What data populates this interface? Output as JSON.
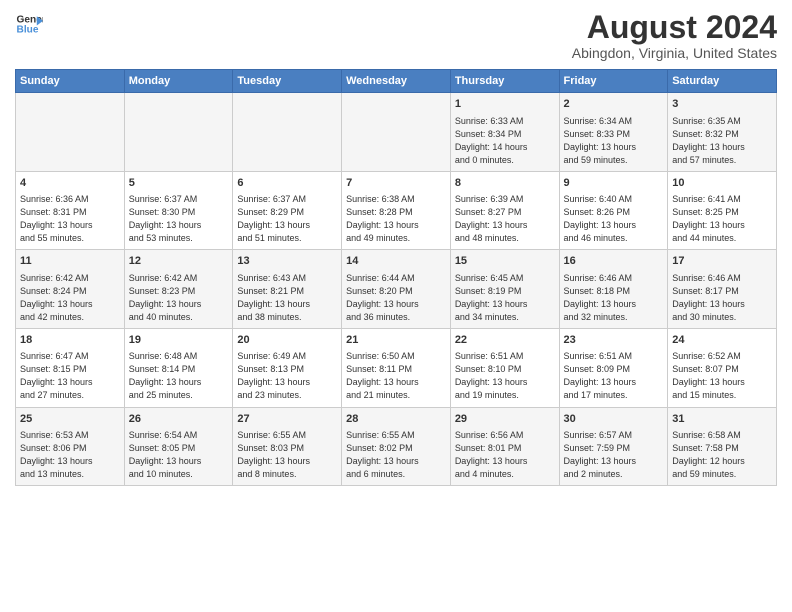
{
  "header": {
    "logo_line1": "General",
    "logo_line2": "Blue",
    "title": "August 2024",
    "subtitle": "Abingdon, Virginia, United States"
  },
  "columns": [
    "Sunday",
    "Monday",
    "Tuesday",
    "Wednesday",
    "Thursday",
    "Friday",
    "Saturday"
  ],
  "weeks": [
    [
      {
        "day": "",
        "lines": []
      },
      {
        "day": "",
        "lines": []
      },
      {
        "day": "",
        "lines": []
      },
      {
        "day": "",
        "lines": []
      },
      {
        "day": "1",
        "lines": [
          "Sunrise: 6:33 AM",
          "Sunset: 8:34 PM",
          "Daylight: 14 hours",
          "and 0 minutes."
        ]
      },
      {
        "day": "2",
        "lines": [
          "Sunrise: 6:34 AM",
          "Sunset: 8:33 PM",
          "Daylight: 13 hours",
          "and 59 minutes."
        ]
      },
      {
        "day": "3",
        "lines": [
          "Sunrise: 6:35 AM",
          "Sunset: 8:32 PM",
          "Daylight: 13 hours",
          "and 57 minutes."
        ]
      }
    ],
    [
      {
        "day": "4",
        "lines": [
          "Sunrise: 6:36 AM",
          "Sunset: 8:31 PM",
          "Daylight: 13 hours",
          "and 55 minutes."
        ]
      },
      {
        "day": "5",
        "lines": [
          "Sunrise: 6:37 AM",
          "Sunset: 8:30 PM",
          "Daylight: 13 hours",
          "and 53 minutes."
        ]
      },
      {
        "day": "6",
        "lines": [
          "Sunrise: 6:37 AM",
          "Sunset: 8:29 PM",
          "Daylight: 13 hours",
          "and 51 minutes."
        ]
      },
      {
        "day": "7",
        "lines": [
          "Sunrise: 6:38 AM",
          "Sunset: 8:28 PM",
          "Daylight: 13 hours",
          "and 49 minutes."
        ]
      },
      {
        "day": "8",
        "lines": [
          "Sunrise: 6:39 AM",
          "Sunset: 8:27 PM",
          "Daylight: 13 hours",
          "and 48 minutes."
        ]
      },
      {
        "day": "9",
        "lines": [
          "Sunrise: 6:40 AM",
          "Sunset: 8:26 PM",
          "Daylight: 13 hours",
          "and 46 minutes."
        ]
      },
      {
        "day": "10",
        "lines": [
          "Sunrise: 6:41 AM",
          "Sunset: 8:25 PM",
          "Daylight: 13 hours",
          "and 44 minutes."
        ]
      }
    ],
    [
      {
        "day": "11",
        "lines": [
          "Sunrise: 6:42 AM",
          "Sunset: 8:24 PM",
          "Daylight: 13 hours",
          "and 42 minutes."
        ]
      },
      {
        "day": "12",
        "lines": [
          "Sunrise: 6:42 AM",
          "Sunset: 8:23 PM",
          "Daylight: 13 hours",
          "and 40 minutes."
        ]
      },
      {
        "day": "13",
        "lines": [
          "Sunrise: 6:43 AM",
          "Sunset: 8:21 PM",
          "Daylight: 13 hours",
          "and 38 minutes."
        ]
      },
      {
        "day": "14",
        "lines": [
          "Sunrise: 6:44 AM",
          "Sunset: 8:20 PM",
          "Daylight: 13 hours",
          "and 36 minutes."
        ]
      },
      {
        "day": "15",
        "lines": [
          "Sunrise: 6:45 AM",
          "Sunset: 8:19 PM",
          "Daylight: 13 hours",
          "and 34 minutes."
        ]
      },
      {
        "day": "16",
        "lines": [
          "Sunrise: 6:46 AM",
          "Sunset: 8:18 PM",
          "Daylight: 13 hours",
          "and 32 minutes."
        ]
      },
      {
        "day": "17",
        "lines": [
          "Sunrise: 6:46 AM",
          "Sunset: 8:17 PM",
          "Daylight: 13 hours",
          "and 30 minutes."
        ]
      }
    ],
    [
      {
        "day": "18",
        "lines": [
          "Sunrise: 6:47 AM",
          "Sunset: 8:15 PM",
          "Daylight: 13 hours",
          "and 27 minutes."
        ]
      },
      {
        "day": "19",
        "lines": [
          "Sunrise: 6:48 AM",
          "Sunset: 8:14 PM",
          "Daylight: 13 hours",
          "and 25 minutes."
        ]
      },
      {
        "day": "20",
        "lines": [
          "Sunrise: 6:49 AM",
          "Sunset: 8:13 PM",
          "Daylight: 13 hours",
          "and 23 minutes."
        ]
      },
      {
        "day": "21",
        "lines": [
          "Sunrise: 6:50 AM",
          "Sunset: 8:11 PM",
          "Daylight: 13 hours",
          "and 21 minutes."
        ]
      },
      {
        "day": "22",
        "lines": [
          "Sunrise: 6:51 AM",
          "Sunset: 8:10 PM",
          "Daylight: 13 hours",
          "and 19 minutes."
        ]
      },
      {
        "day": "23",
        "lines": [
          "Sunrise: 6:51 AM",
          "Sunset: 8:09 PM",
          "Daylight: 13 hours",
          "and 17 minutes."
        ]
      },
      {
        "day": "24",
        "lines": [
          "Sunrise: 6:52 AM",
          "Sunset: 8:07 PM",
          "Daylight: 13 hours",
          "and 15 minutes."
        ]
      }
    ],
    [
      {
        "day": "25",
        "lines": [
          "Sunrise: 6:53 AM",
          "Sunset: 8:06 PM",
          "Daylight: 13 hours",
          "and 13 minutes."
        ]
      },
      {
        "day": "26",
        "lines": [
          "Sunrise: 6:54 AM",
          "Sunset: 8:05 PM",
          "Daylight: 13 hours",
          "and 10 minutes."
        ]
      },
      {
        "day": "27",
        "lines": [
          "Sunrise: 6:55 AM",
          "Sunset: 8:03 PM",
          "Daylight: 13 hours",
          "and 8 minutes."
        ]
      },
      {
        "day": "28",
        "lines": [
          "Sunrise: 6:55 AM",
          "Sunset: 8:02 PM",
          "Daylight: 13 hours",
          "and 6 minutes."
        ]
      },
      {
        "day": "29",
        "lines": [
          "Sunrise: 6:56 AM",
          "Sunset: 8:01 PM",
          "Daylight: 13 hours",
          "and 4 minutes."
        ]
      },
      {
        "day": "30",
        "lines": [
          "Sunrise: 6:57 AM",
          "Sunset: 7:59 PM",
          "Daylight: 13 hours",
          "and 2 minutes."
        ]
      },
      {
        "day": "31",
        "lines": [
          "Sunrise: 6:58 AM",
          "Sunset: 7:58 PM",
          "Daylight: 12 hours",
          "and 59 minutes."
        ]
      }
    ]
  ]
}
